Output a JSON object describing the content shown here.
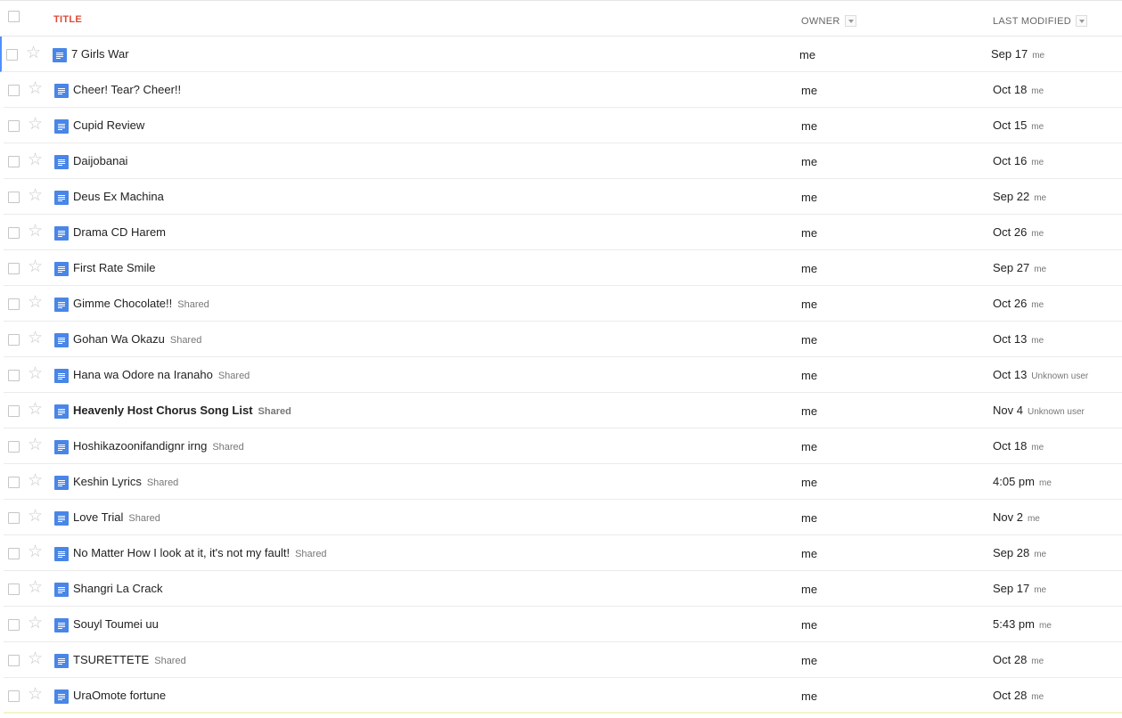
{
  "header": {
    "title_label": "TITLE",
    "owner_label": "OWNER",
    "modified_label": "LAST MODIFIED"
  },
  "icons": {
    "star": "star-outline-icon",
    "doc": "document-icon",
    "sort": "sort-arrow-down-icon"
  },
  "colors": {
    "title_header": "#dd4b39",
    "doc_icon": "#4986e7",
    "active_row_marker": "#4d90fe"
  },
  "rows": [
    {
      "title": "7 Girls War",
      "shared": "",
      "bold": false,
      "owner": "me",
      "modified": "Sep 17",
      "modifier": "me"
    },
    {
      "title": "Cheer! Tear? Cheer!!",
      "shared": "",
      "bold": false,
      "owner": "me",
      "modified": "Oct 18",
      "modifier": "me"
    },
    {
      "title": "Cupid Review",
      "shared": "",
      "bold": false,
      "owner": "me",
      "modified": "Oct 15",
      "modifier": "me"
    },
    {
      "title": "Daijobanai",
      "shared": "",
      "bold": false,
      "owner": "me",
      "modified": "Oct 16",
      "modifier": "me"
    },
    {
      "title": "Deus Ex Machina",
      "shared": "",
      "bold": false,
      "owner": "me",
      "modified": "Sep 22",
      "modifier": "me"
    },
    {
      "title": "Drama CD Harem",
      "shared": "",
      "bold": false,
      "owner": "me",
      "modified": "Oct 26",
      "modifier": "me"
    },
    {
      "title": "First Rate Smile",
      "shared": "",
      "bold": false,
      "owner": "me",
      "modified": "Sep 27",
      "modifier": "me"
    },
    {
      "title": "Gimme Chocolate!!",
      "shared": "Shared",
      "bold": false,
      "owner": "me",
      "modified": "Oct 26",
      "modifier": "me"
    },
    {
      "title": "Gohan Wa Okazu",
      "shared": "Shared",
      "bold": false,
      "owner": "me",
      "modified": "Oct 13",
      "modifier": "me"
    },
    {
      "title": "Hana wa Odore na Iranaho",
      "shared": "Shared",
      "bold": false,
      "owner": "me",
      "modified": "Oct 13",
      "modifier": "Unknown user"
    },
    {
      "title": "Heavenly Host Chorus Song List",
      "shared": "Shared",
      "bold": true,
      "owner": "me",
      "modified": "Nov 4",
      "modifier": "Unknown user"
    },
    {
      "title": "Hoshikazoonifandignr irng",
      "shared": "Shared",
      "bold": false,
      "owner": "me",
      "modified": "Oct 18",
      "modifier": "me"
    },
    {
      "title": "Keshin Lyrics",
      "shared": "Shared",
      "bold": false,
      "owner": "me",
      "modified": "4:05 pm",
      "modifier": "me"
    },
    {
      "title": "Love Trial",
      "shared": "Shared",
      "bold": false,
      "owner": "me",
      "modified": "Nov 2",
      "modifier": "me"
    },
    {
      "title": "No Matter How I look at it, it's not my fault!",
      "shared": "Shared",
      "bold": false,
      "owner": "me",
      "modified": "Sep 28",
      "modifier": "me"
    },
    {
      "title": "Shangri La Crack",
      "shared": "",
      "bold": false,
      "owner": "me",
      "modified": "Sep 17",
      "modifier": "me"
    },
    {
      "title": "Souyl Toumei uu",
      "shared": "",
      "bold": false,
      "owner": "me",
      "modified": "5:43 pm",
      "modifier": "me"
    },
    {
      "title": "TSURETTETE",
      "shared": "Shared",
      "bold": false,
      "owner": "me",
      "modified": "Oct 28",
      "modifier": "me"
    },
    {
      "title": "UraOmote fortune",
      "shared": "",
      "bold": false,
      "owner": "me",
      "modified": "Oct 28",
      "modifier": "me"
    }
  ]
}
